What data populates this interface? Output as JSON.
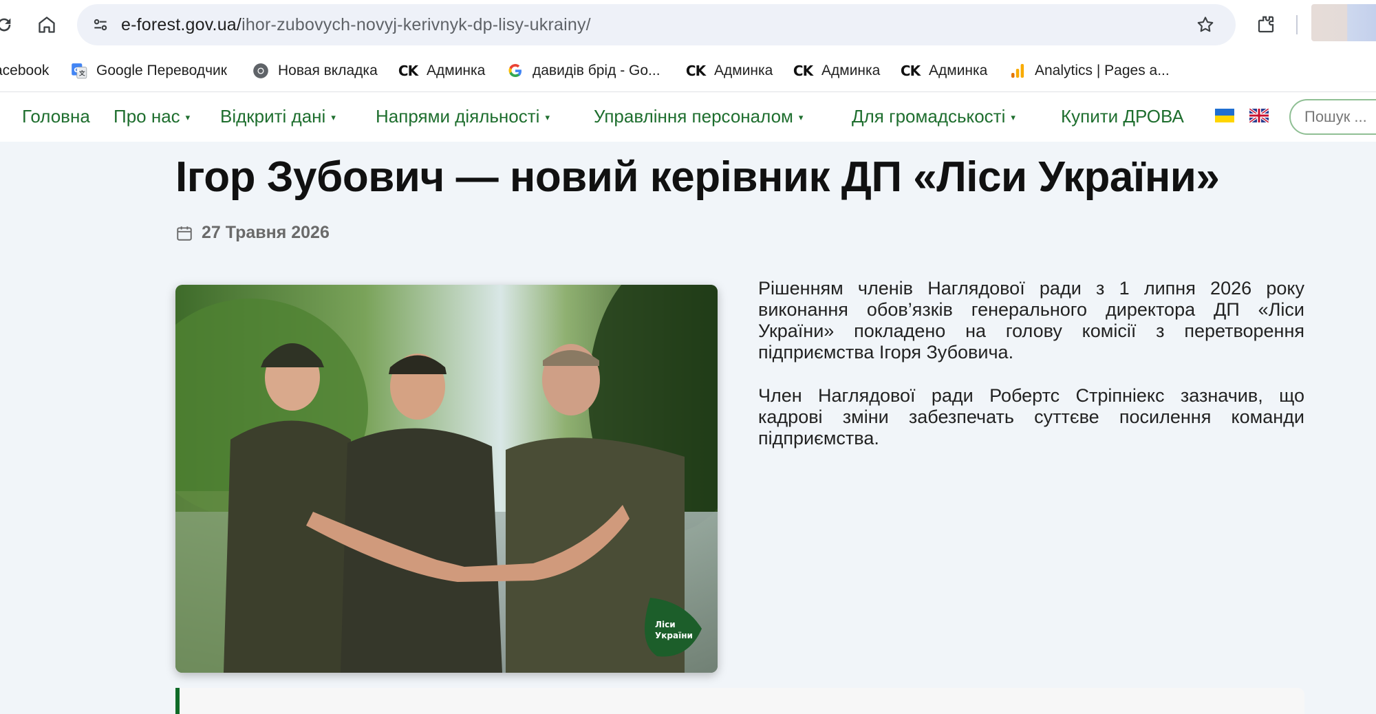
{
  "browser": {
    "url_host": "e-forest.gov.ua/",
    "url_path": "ihor-zubovych-novyj-kerivnyk-dp-lisy-ukrainy/",
    "icons": [
      "reload-icon",
      "home-icon",
      "site-settings-icon",
      "bookmark-star-icon",
      "extensions-icon"
    ]
  },
  "bookmarks": [
    {
      "label": "acebook",
      "icon": "facebook-icon"
    },
    {
      "label": "Google Переводчик",
      "icon": "google-translate-icon"
    },
    {
      "label": "Новая вкладка",
      "icon": "chrome-icon"
    },
    {
      "label": "Админка",
      "icon": "ck-icon",
      "icon_text": "CK"
    },
    {
      "label": "давидів брід - Go...",
      "icon": "google-icon",
      "icon_text": "G"
    },
    {
      "label": "Админка",
      "icon": "ck-icon",
      "icon_text": "CK"
    },
    {
      "label": "Админка",
      "icon": "ck-icon",
      "icon_text": "CK"
    },
    {
      "label": "Админка",
      "icon": "ck-icon",
      "icon_text": "CK"
    },
    {
      "label": "Analytics | Pages a...",
      "icon": "analytics-icon"
    }
  ],
  "nav": {
    "items": [
      {
        "label": "Головна",
        "has_caret": false
      },
      {
        "label": "Про нас",
        "has_caret": true
      },
      {
        "label": "Відкриті дані",
        "has_caret": true
      },
      {
        "label": "Напрями діяльності",
        "has_caret": true
      },
      {
        "label": "Управління персоналом",
        "has_caret": true
      },
      {
        "label": "Для громадськості",
        "has_caret": true
      },
      {
        "label": "Купити ДРОВА",
        "has_caret": false
      }
    ],
    "caret": "▾",
    "search_placeholder": "Пошук ..."
  },
  "article": {
    "title": "Ігор Зубович — новий керівник ДП «Ліси України»",
    "date": "27 Травня 2026",
    "paragraphs": [
      "Рішенням членів Наглядової ради з 1 липня 2026 року виконання обов’язків генерального директора ДП «Ліси України» покладено на голову комісії з перетворення підприємства Ігоря Зубовича.",
      "Член Наглядової ради Робертс Стріпніекс зазначив, що кадрові зміни забезпечать суттєве посилення команди підприємства."
    ],
    "photo_logo": [
      "Ліси",
      "України"
    ]
  },
  "colors": {
    "nav_green": "#1e6e2e",
    "accent_green": "#0f6b28",
    "page_bg": "#f1f5f9"
  }
}
